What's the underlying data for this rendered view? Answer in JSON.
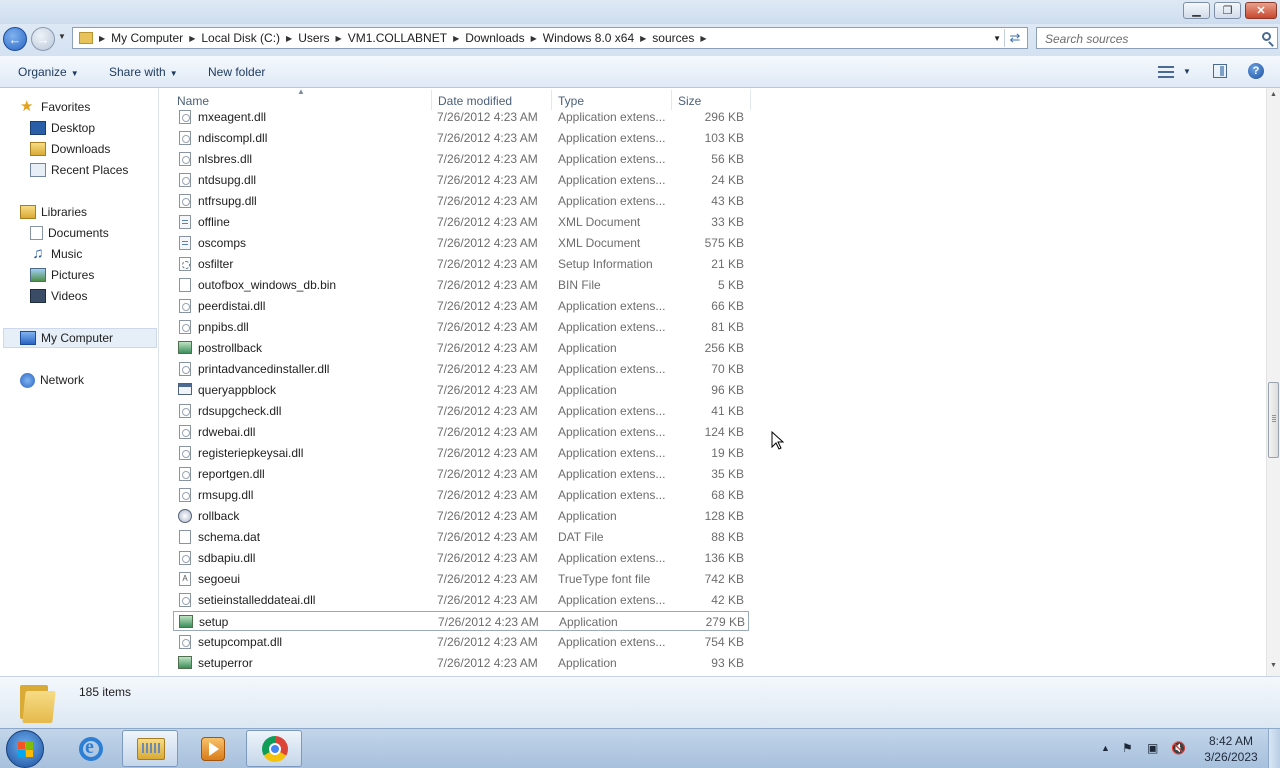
{
  "window": {
    "controls": {
      "minimize": "▁",
      "maximize": "❐",
      "close": "✕"
    }
  },
  "address": {
    "crumbs": [
      "My Computer",
      "Local Disk (C:)",
      "Users",
      "VM1.COLLABNET",
      "Downloads",
      "Windows 8.0 x64",
      "sources"
    ],
    "search_placeholder": "Search sources"
  },
  "toolbar": {
    "organize": "Organize",
    "share_with": "Share with",
    "new_folder": "New folder",
    "help": "?"
  },
  "nav": {
    "favorites": {
      "label": "Favorites",
      "items": [
        "Desktop",
        "Downloads",
        "Recent Places"
      ]
    },
    "libraries": {
      "label": "Libraries",
      "items": [
        "Documents",
        "Music",
        "Pictures",
        "Videos"
      ]
    },
    "computer": "My Computer",
    "network": "Network"
  },
  "columns": {
    "name": "Name",
    "date": "Date modified",
    "type": "Type",
    "size": "Size"
  },
  "files": [
    {
      "name": "mxeagent.dll",
      "date": "7/26/2012 4:23 AM",
      "type": "Application extens...",
      "size": "296 KB",
      "icon": "dll-file-icon"
    },
    {
      "name": "ndiscompl.dll",
      "date": "7/26/2012 4:23 AM",
      "type": "Application extens...",
      "size": "103 KB",
      "icon": "dll-file-icon"
    },
    {
      "name": "nlsbres.dll",
      "date": "7/26/2012 4:23 AM",
      "type": "Application extens...",
      "size": "56 KB",
      "icon": "dll-file-icon"
    },
    {
      "name": "ntdsupg.dll",
      "date": "7/26/2012 4:23 AM",
      "type": "Application extens...",
      "size": "24 KB",
      "icon": "dll-file-icon"
    },
    {
      "name": "ntfrsupg.dll",
      "date": "7/26/2012 4:23 AM",
      "type": "Application extens...",
      "size": "43 KB",
      "icon": "dll-file-icon"
    },
    {
      "name": "offline",
      "date": "7/26/2012 4:23 AM",
      "type": "XML Document",
      "size": "33 KB",
      "icon": "xml-file-icon"
    },
    {
      "name": "oscomps",
      "date": "7/26/2012 4:23 AM",
      "type": "XML Document",
      "size": "575 KB",
      "icon": "xml-file-icon"
    },
    {
      "name": "osfilter",
      "date": "7/26/2012 4:23 AM",
      "type": "Setup Information",
      "size": "21 KB",
      "icon": "setup-info-file-icon"
    },
    {
      "name": "outofbox_windows_db.bin",
      "date": "7/26/2012 4:23 AM",
      "type": "BIN File",
      "size": "5 KB",
      "icon": "blank-file-icon"
    },
    {
      "name": "peerdistai.dll",
      "date": "7/26/2012 4:23 AM",
      "type": "Application extens...",
      "size": "66 KB",
      "icon": "dll-file-icon"
    },
    {
      "name": "pnpibs.dll",
      "date": "7/26/2012 4:23 AM",
      "type": "Application extens...",
      "size": "81 KB",
      "icon": "dll-file-icon"
    },
    {
      "name": "postrollback",
      "date": "7/26/2012 4:23 AM",
      "type": "Application",
      "size": "256 KB",
      "icon": "setup-app-icon"
    },
    {
      "name": "printadvancedinstaller.dll",
      "date": "7/26/2012 4:23 AM",
      "type": "Application extens...",
      "size": "70 KB",
      "icon": "dll-file-icon"
    },
    {
      "name": "queryappblock",
      "date": "7/26/2012 4:23 AM",
      "type": "Application",
      "size": "96 KB",
      "icon": "window-app-icon"
    },
    {
      "name": "rdsupgcheck.dll",
      "date": "7/26/2012 4:23 AM",
      "type": "Application extens...",
      "size": "41 KB",
      "icon": "dll-file-icon"
    },
    {
      "name": "rdwebai.dll",
      "date": "7/26/2012 4:23 AM",
      "type": "Application extens...",
      "size": "124 KB",
      "icon": "dll-file-icon"
    },
    {
      "name": "registeriepkeysai.dll",
      "date": "7/26/2012 4:23 AM",
      "type": "Application extens...",
      "size": "19 KB",
      "icon": "dll-file-icon"
    },
    {
      "name": "reportgen.dll",
      "date": "7/26/2012 4:23 AM",
      "type": "Application extens...",
      "size": "35 KB",
      "icon": "dll-file-icon"
    },
    {
      "name": "rmsupg.dll",
      "date": "7/26/2012 4:23 AM",
      "type": "Application extens...",
      "size": "68 KB",
      "icon": "dll-file-icon"
    },
    {
      "name": "rollback",
      "date": "7/26/2012 4:23 AM",
      "type": "Application",
      "size": "128 KB",
      "icon": "rollback-app-icon"
    },
    {
      "name": "schema.dat",
      "date": "7/26/2012 4:23 AM",
      "type": "DAT File",
      "size": "88 KB",
      "icon": "blank-file-icon"
    },
    {
      "name": "sdbapiu.dll",
      "date": "7/26/2012 4:23 AM",
      "type": "Application extens...",
      "size": "136 KB",
      "icon": "dll-file-icon"
    },
    {
      "name": "segoeui",
      "date": "7/26/2012 4:23 AM",
      "type": "TrueType font file",
      "size": "742 KB",
      "icon": "font-file-icon"
    },
    {
      "name": "setieinstalleddateai.dll",
      "date": "7/26/2012 4:23 AM",
      "type": "Application extens...",
      "size": "42 KB",
      "icon": "dll-file-icon"
    },
    {
      "name": "setup",
      "date": "7/26/2012 4:23 AM",
      "type": "Application",
      "size": "279 KB",
      "icon": "setup-app-icon",
      "selected": true
    },
    {
      "name": "setupcompat.dll",
      "date": "7/26/2012 4:23 AM",
      "type": "Application extens...",
      "size": "754 KB",
      "icon": "dll-file-icon"
    },
    {
      "name": "setuperror",
      "date": "7/26/2012 4:23 AM",
      "type": "Application",
      "size": "93 KB",
      "icon": "setup-app-icon"
    }
  ],
  "details": {
    "item_count": "185 items"
  },
  "taskbar": {
    "clock_time": "8:42 AM",
    "clock_date": "3/26/2023"
  }
}
